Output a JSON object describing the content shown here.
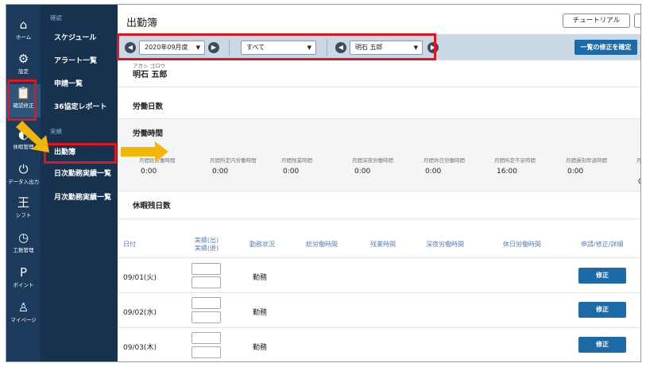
{
  "rail": [
    {
      "icon": "⌂",
      "label": "ホーム"
    },
    {
      "icon": "⚙",
      "label": "設定"
    },
    {
      "icon": "📋",
      "label": "確認修正"
    },
    {
      "icon": "◐",
      "label": "休暇管理"
    },
    {
      "icon": "⏻",
      "label": "データ入出力"
    },
    {
      "icon": "王",
      "label": "シフト"
    },
    {
      "icon": "◷",
      "label": "工数管理"
    },
    {
      "icon": "P",
      "label": "ポイント"
    },
    {
      "icon": "♙",
      "label": "マイページ"
    }
  ],
  "subnav": {
    "section1": "確認",
    "items1": [
      "スケジュール",
      "アラート一覧",
      "申請一覧",
      "36協定レポート"
    ],
    "section2": "実績",
    "items2": [
      "出勤簿",
      "日次勤務実績一覧",
      "月次勤務実績一覧"
    ]
  },
  "header": {
    "title": "出勤簿",
    "tutorial": "チュートリアル"
  },
  "filters": {
    "month": "2020年09月度",
    "group": "すべて",
    "employee": "明石 五郎",
    "confirm_all": "一覧の修正を確定"
  },
  "employee": {
    "furigana": "アカシ ゴロウ",
    "name": "明石 五郎"
  },
  "sections": {
    "work_days": "労働日数",
    "work_hours": "労働時間",
    "leave_days": "休暇残日数"
  },
  "time_metrics": [
    {
      "label": "月間総労働時間",
      "value": "0:00"
    },
    {
      "label": "月間所定内労働時間",
      "value": "0:00"
    },
    {
      "label": "月間残業時間",
      "value": "0:00"
    },
    {
      "label": "月間深夜労働時間",
      "value": "0:00"
    },
    {
      "label": "月間休日労働時間",
      "value": "0:00"
    },
    {
      "label": "月間所定不足時間",
      "value": "16:00"
    },
    {
      "label": "月間遅刻早退時間",
      "value": "0:00"
    },
    {
      "label": "月",
      "value": "0"
    }
  ],
  "table": {
    "headers": {
      "date": "日付",
      "actual_in": "実績(出)",
      "actual_out": "実績(退)",
      "status": "勤務状況",
      "total": "総労働時間",
      "overtime": "残業時間",
      "night": "深夜労働時間",
      "holiday": "休日労働時間",
      "action": "申請/修正/詳細"
    },
    "rows": [
      {
        "date": "09/01(火)",
        "status": "勤務",
        "button": "修正"
      },
      {
        "date": "09/02(水)",
        "status": "勤務",
        "button": "修正"
      },
      {
        "date": "09/03(木)",
        "status": "勤務",
        "button": "修正"
      }
    ]
  },
  "colors": {
    "rail_bg": "#1b3a5c",
    "subnav_bg": "#17324f",
    "accent": "#1c6aa8",
    "highlight": "#e2141d",
    "arrow": "#f2b705"
  }
}
